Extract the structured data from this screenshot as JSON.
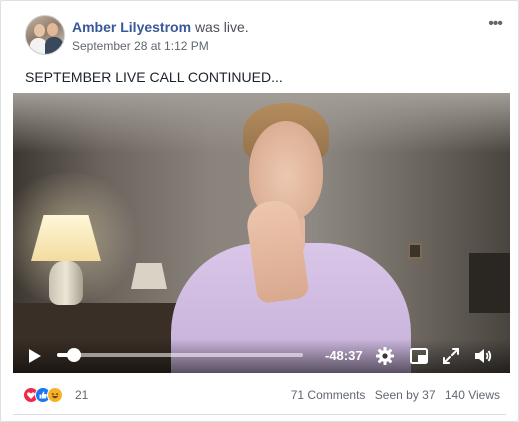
{
  "post": {
    "author": "Amber Lilyestrom",
    "action": "was live.",
    "timestamp": "September 28 at 1:12 PM",
    "text": "SEPTEMBER LIVE CALL CONTINUED...",
    "more_label": "•••"
  },
  "video": {
    "time_remaining": "-48:37",
    "progress": 0.07,
    "icons": [
      "play-icon",
      "gear-icon",
      "picture-in-picture-icon",
      "fullscreen-icon",
      "volume-icon"
    ]
  },
  "footer": {
    "reaction_icons": [
      "love-reaction-icon",
      "like-reaction-icon",
      "haha-reaction-icon"
    ],
    "reaction_count": "21",
    "comments": "71 Comments",
    "seen": "Seen by 37",
    "views": "140 Views"
  },
  "colors": {
    "name_link": "#385898",
    "love": "#f0284a",
    "like": "#1877f2",
    "haha": "#f7b125"
  }
}
